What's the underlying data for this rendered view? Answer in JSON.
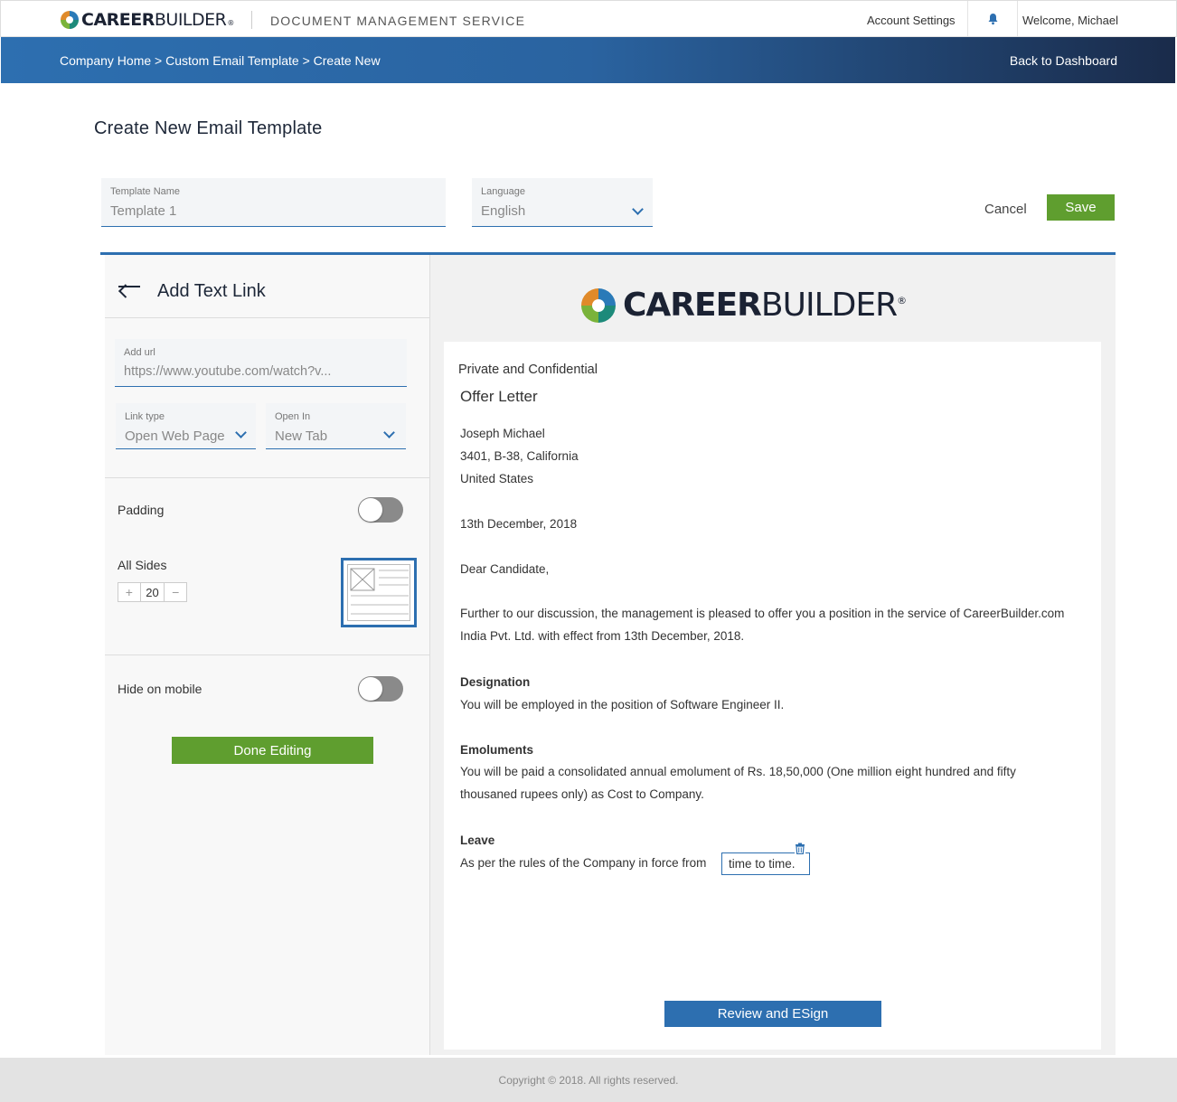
{
  "header": {
    "brand_bold": "CAREER",
    "brand_light": "BUILDER",
    "brand_reg": "®",
    "service_title": "DOCUMENT MANAGEMENT SERVICE",
    "account_settings": "Account Settings",
    "welcome": "Welcome, Michael"
  },
  "nav": {
    "breadcrumb": "Company Home > Custom Email Template > Create New",
    "back_to_dashboard": "Back to Dashboard"
  },
  "page": {
    "title": "Create New Email Template",
    "template_name_label": "Template Name",
    "template_name_value": "Template 1",
    "language_label": "Language",
    "language_value": "English",
    "cancel": "Cancel",
    "save": "Save"
  },
  "panel": {
    "title": "Add Text Link",
    "url_label": "Add url",
    "url_value": "https://www.youtube.com/watch?v...",
    "link_type_label": "Link type",
    "link_type_value": "Open Web Page",
    "open_in_label": "Open In",
    "open_in_value": "New Tab",
    "padding_label": "Padding",
    "padding_on": false,
    "all_sides_label": "All Sides",
    "padding_value": "20",
    "plus": "+",
    "minus": "−",
    "hide_mobile_label": "Hide on mobile",
    "hide_mobile_on": false,
    "done_button": "Done Editing"
  },
  "letter": {
    "confidential": "Private and Confidential",
    "heading": "Offer Letter",
    "name": "Joseph Michael",
    "address1": "3401, B-38, California",
    "address2": "United States",
    "date": "13th December, 2018",
    "salutation": "Dear Candidate,",
    "intro": "Further to our discussion, the management is pleased to offer you a position in the service of CareerBuilder.com India Pvt. Ltd. with effect from 13th December, 2018.",
    "designation_heading": "Designation",
    "designation_text": "You will be employed in the position of Software Engineer II.",
    "emoluments_heading": "Emoluments",
    "emoluments_text": "You will be paid a consolidated annual emolument of Rs. 18,50,000 (One million eight hundred and fifty thousaned rupees only) as Cost to Company.",
    "leave_heading": "Leave",
    "leave_text": "As per the rules of the Company in force from",
    "link_text": "time to time.",
    "esign_button": "Review and ESign"
  },
  "footer": {
    "copyright": "Copyright © 2018. All rights reserved."
  },
  "colors": {
    "accent_blue": "#2d6fb0",
    "action_green": "#5f9e2f",
    "nav_dark": "#1a2b4a"
  }
}
